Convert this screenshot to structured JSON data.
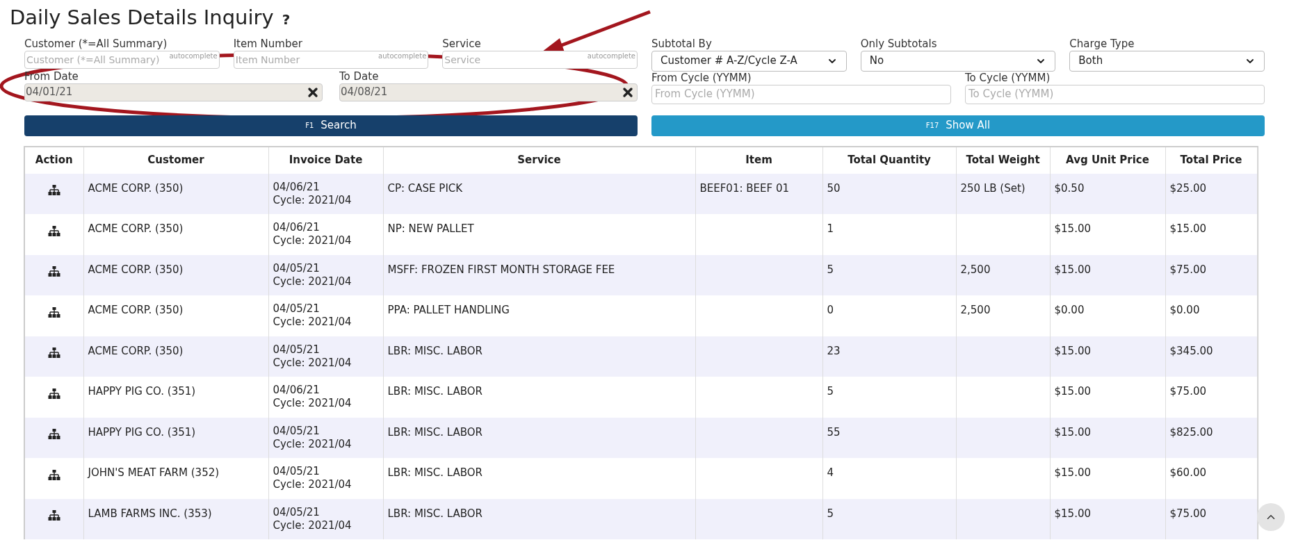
{
  "title": "Daily Sales Details Inquiry",
  "help": "?",
  "filters_left_top": [
    {
      "label": "Customer (*=All Summary)",
      "placeholder": "Customer (*=All Summary)",
      "hint": "autocomplete"
    },
    {
      "label": "Item Number",
      "placeholder": "Item Number",
      "hint": "autocomplete"
    },
    {
      "label": "Service",
      "placeholder": "Service",
      "hint": "autocomplete"
    }
  ],
  "filters_left_dates": [
    {
      "label": "From Date",
      "value": "04/01/21"
    },
    {
      "label": "To Date",
      "value": "04/08/21"
    }
  ],
  "filters_right_selects": [
    {
      "label": "Subtotal By",
      "value": "Customer # A-Z/Cycle Z-A"
    },
    {
      "label": "Only Subtotals",
      "value": "No"
    },
    {
      "label": "Charge Type",
      "value": "Both"
    }
  ],
  "filters_right_cycles": [
    {
      "label": "From Cycle (YYMM)",
      "placeholder": "From Cycle (YYMM)"
    },
    {
      "label": "To Cycle (YYMM)",
      "placeholder": "To Cycle (YYMM)"
    }
  ],
  "buttons": [
    {
      "key": "F1",
      "label": "Search",
      "kind": "primary"
    },
    {
      "key": "F17",
      "label": "Show All",
      "kind": "secondary"
    }
  ],
  "table": {
    "columns": [
      "Action",
      "Customer",
      "Invoice Date",
      "Service",
      "Item",
      "Total Quantity",
      "Total Weight",
      "Avg Unit Price",
      "Total Price"
    ],
    "rows": [
      {
        "customer": "ACME CORP. (350)",
        "date": "04/06/21",
        "cycle": "Cycle: 2021/04",
        "service": "CP: CASE PICK",
        "item": "BEEF01: BEEF 01",
        "quantity": "50",
        "weight": "250 LB (Set)",
        "unit_price": "$0.50",
        "total": "$25.00"
      },
      {
        "customer": "ACME CORP. (350)",
        "date": "04/06/21",
        "cycle": "Cycle: 2021/04",
        "service": "NP: NEW PALLET",
        "item": "",
        "quantity": "1",
        "weight": "",
        "unit_price": "$15.00",
        "total": "$15.00"
      },
      {
        "customer": "ACME CORP. (350)",
        "date": "04/05/21",
        "cycle": "Cycle: 2021/04",
        "service": "MSFF: FROZEN FIRST MONTH STORAGE FEE",
        "item": "",
        "quantity": "5",
        "weight": "2,500",
        "unit_price": "$15.00",
        "total": "$75.00"
      },
      {
        "customer": "ACME CORP. (350)",
        "date": "04/05/21",
        "cycle": "Cycle: 2021/04",
        "service": "PPA: PALLET HANDLING",
        "item": "",
        "quantity": "0",
        "weight": "2,500",
        "unit_price": "$0.00",
        "total": "$0.00"
      },
      {
        "customer": "ACME CORP. (350)",
        "date": "04/05/21",
        "cycle": "Cycle: 2021/04",
        "service": "LBR: MISC. LABOR",
        "item": "",
        "quantity": "23",
        "weight": "",
        "unit_price": "$15.00",
        "total": "$345.00"
      },
      {
        "customer": "HAPPY PIG CO. (351)",
        "date": "04/06/21",
        "cycle": "Cycle: 2021/04",
        "service": "LBR: MISC. LABOR",
        "item": "",
        "quantity": "5",
        "weight": "",
        "unit_price": "$15.00",
        "total": "$75.00"
      },
      {
        "customer": "HAPPY PIG CO. (351)",
        "date": "04/05/21",
        "cycle": "Cycle: 2021/04",
        "service": "LBR: MISC. LABOR",
        "item": "",
        "quantity": "55",
        "weight": "",
        "unit_price": "$15.00",
        "total": "$825.00"
      },
      {
        "customer": "JOHN'S MEAT FARM (352)",
        "date": "04/05/21",
        "cycle": "Cycle: 2021/04",
        "service": "LBR: MISC. LABOR",
        "item": "",
        "quantity": "4",
        "weight": "",
        "unit_price": "$15.00",
        "total": "$60.00"
      },
      {
        "customer": "LAMB FARMS INC. (353)",
        "date": "04/05/21",
        "cycle": "Cycle: 2021/04",
        "service": "LBR: MISC. LABOR",
        "item": "",
        "quantity": "5",
        "weight": "",
        "unit_price": "$15.00",
        "total": "$75.00"
      }
    ]
  }
}
